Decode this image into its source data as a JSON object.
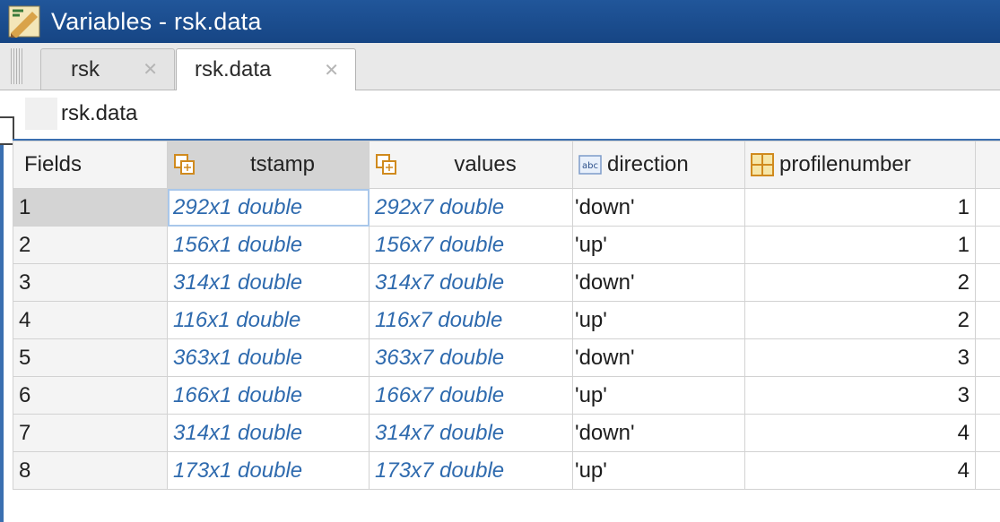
{
  "window": {
    "title": "Variables - rsk.data",
    "title_icon": "variable-editor-icon"
  },
  "tabs": [
    {
      "label": "rsk",
      "close_icon": "close-icon",
      "active": false
    },
    {
      "label": "rsk.data",
      "close_icon": "close-icon",
      "active": true
    }
  ],
  "path": {
    "label": "rsk.data",
    "icon": "struct-array-icon"
  },
  "table": {
    "row_header_title": "Fields",
    "columns": [
      {
        "label": "tstamp",
        "icon": "cell-array-icon"
      },
      {
        "label": "values",
        "icon": "cell-array-icon"
      },
      {
        "label": "direction",
        "icon": "abc-text-icon"
      },
      {
        "label": "profilenumber",
        "icon": "numeric-grid-icon"
      }
    ],
    "rows": [
      {
        "index": "1",
        "tstamp": "292x1 double",
        "values": "292x7 double",
        "direction": "'down'",
        "profilenumber": "1"
      },
      {
        "index": "2",
        "tstamp": "156x1 double",
        "values": "156x7 double",
        "direction": "'up'",
        "profilenumber": "1"
      },
      {
        "index": "3",
        "tstamp": "314x1 double",
        "values": "314x7 double",
        "direction": "'down'",
        "profilenumber": "2"
      },
      {
        "index": "4",
        "tstamp": "116x1 double",
        "values": "116x7 double",
        "direction": "'up'",
        "profilenumber": "2"
      },
      {
        "index": "5",
        "tstamp": "363x1 double",
        "values": "363x7 double",
        "direction": "'down'",
        "profilenumber": "3"
      },
      {
        "index": "6",
        "tstamp": "166x1 double",
        "values": "166x7 double",
        "direction": "'up'",
        "profilenumber": "3"
      },
      {
        "index": "7",
        "tstamp": "314x1 double",
        "values": "314x7 double",
        "direction": "'down'",
        "profilenumber": "4"
      },
      {
        "index": "8",
        "tstamp": "173x1 double",
        "values": "173x7 double",
        "direction": "'up'",
        "profilenumber": "4"
      }
    ]
  },
  "colors": {
    "titlebar": "#1a4d8f",
    "link_text": "#2e6aae",
    "selected_header": "#d4d4d4"
  }
}
